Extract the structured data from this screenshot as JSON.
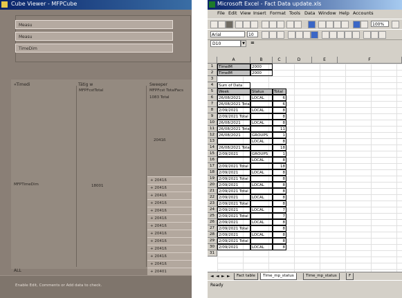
{
  "cube_viewer": {
    "title": "Cube Viewer - MFPCube",
    "dimensions": [
      "Measu",
      "Measu",
      "TimeDim"
    ],
    "headers": [
      "«Timedi",
      "Tätig w",
      "Sweeper "
    ],
    "sub_labels": {
      "col2_top": "MFPFcstTotal",
      "col3_top": "MFPFcst TotalFacs",
      "col3_second": "1083 Total",
      "col3_mid": "2041ß",
      "row_label": "MFPTimeDim",
      "col2_mid": "18001"
    },
    "periods": [
      "+ 2041ß",
      "+ 2041ß",
      "+ 2041ß",
      "+ 2041ß",
      "+ 2041ß",
      "+ 2041ß",
      "+ 2041ß",
      "+ 2041ß",
      "+ 2041ß",
      "+ 2041ß",
      "+ 2041ß",
      "+ 2041ß",
      "+ 20401"
    ],
    "all_label": "ALL",
    "status": "Enable Edit, Comments or Add data to check."
  },
  "excel": {
    "title": "Microsoft Excel - Fact Data update.xls",
    "menu": [
      "File",
      "Edit",
      "View",
      "Insert",
      "Format",
      "Tools",
      "Data",
      "Window",
      "Help",
      "Accounts"
    ],
    "font_name": "Arial",
    "font_size": "10",
    "zoom": "100%",
    "name_box": "D10",
    "columns": [
      "A",
      "B",
      "C",
      "D",
      "E",
      "F"
    ],
    "rows": [
      "1",
      "2",
      "3",
      "4",
      "5",
      "6",
      "7",
      "8",
      "9",
      "10",
      "11",
      "12",
      "13",
      "14",
      "15",
      "16",
      "17",
      "18",
      "19",
      "20",
      "21",
      "22",
      "23",
      "24",
      "25",
      "26",
      "27",
      "28",
      "29",
      "30",
      "31"
    ],
    "page_fields": [
      {
        "row": "1",
        "label": "TimeIM",
        "value": "2000"
      },
      {
        "row": "2",
        "label": "TimeIM",
        "value": "2000"
      }
    ],
    "pivot_header": "Sum of Data",
    "pivot_cols": [
      "Week",
      "Status",
      "Total"
    ],
    "pivot_rows": [
      {
        "row": "6",
        "a": "26/08/2021",
        "b": "LOCAL",
        "c": "6"
      },
      {
        "row": "7",
        "a": "26/08/2021 Total",
        "b": "",
        "c": "6"
      },
      {
        "row": "8",
        "a": "2/09/2021",
        "b": "LOCAL",
        "c": "8"
      },
      {
        "row": "9",
        "a": "2/09/2021 Total",
        "b": "",
        "c": "8"
      },
      {
        "row": "10",
        "a": "26/08/2021",
        "b": "LOCAL",
        "c": "8"
      },
      {
        "row": "11",
        "a": "26/08/2021 Total",
        "b": "",
        "c": "11"
      },
      {
        "row": "12",
        "a": "26/08/2021",
        "b": "GROUPS",
        "c": "1"
      },
      {
        "row": "13",
        "a": "",
        "b": "LOCAL",
        "c": "8"
      },
      {
        "row": "14",
        "a": "26/08/2021 Total",
        "b": "",
        "c": "18"
      },
      {
        "row": "15",
        "a": "2/09/2021",
        "b": "GROUPS",
        "c": "1"
      },
      {
        "row": "16",
        "a": "",
        "b": "LOCAL",
        "c": "8"
      },
      {
        "row": "17",
        "a": "2/09/2021 Total",
        "b": "",
        "c": "18"
      },
      {
        "row": "18",
        "a": "2/09/2021",
        "b": "LOCAL",
        "c": "8"
      },
      {
        "row": "19",
        "a": "2/09/2021 Total",
        "b": "",
        "c": "8"
      },
      {
        "row": "20",
        "a": "2/09/2021",
        "b": "LOCAL",
        "c": "8"
      },
      {
        "row": "21",
        "a": "2/09/2021 Total",
        "b": "",
        "c": "8"
      },
      {
        "row": "22",
        "a": "2/09/2021",
        "b": "LOCAL",
        "c": "8"
      },
      {
        "row": "23",
        "a": "2/09/2021 Total",
        "b": "",
        "c": "8"
      },
      {
        "row": "24",
        "a": "2/09/2021",
        "b": "LOCAL",
        "c": "7"
      },
      {
        "row": "25",
        "a": "2/09/2021 Total",
        "b": "",
        "c": "7"
      },
      {
        "row": "26",
        "a": "2/09/2021",
        "b": "LOCAL",
        "c": "8"
      },
      {
        "row": "27",
        "a": "2/09/2021 Total",
        "b": "",
        "c": "8"
      },
      {
        "row": "28",
        "a": "2/09/2021",
        "b": "LOCAL",
        "c": "8"
      },
      {
        "row": "29",
        "a": "2/09/2021 Total",
        "b": "",
        "c": "8"
      },
      {
        "row": "30",
        "a": "2/09/2021",
        "b": "LOCAL",
        "c": "8"
      }
    ],
    "sheet_tabs": [
      "Fact table",
      "Time_mp_status",
      "Time_mp_status",
      "F"
    ],
    "status_text": "Ready"
  }
}
